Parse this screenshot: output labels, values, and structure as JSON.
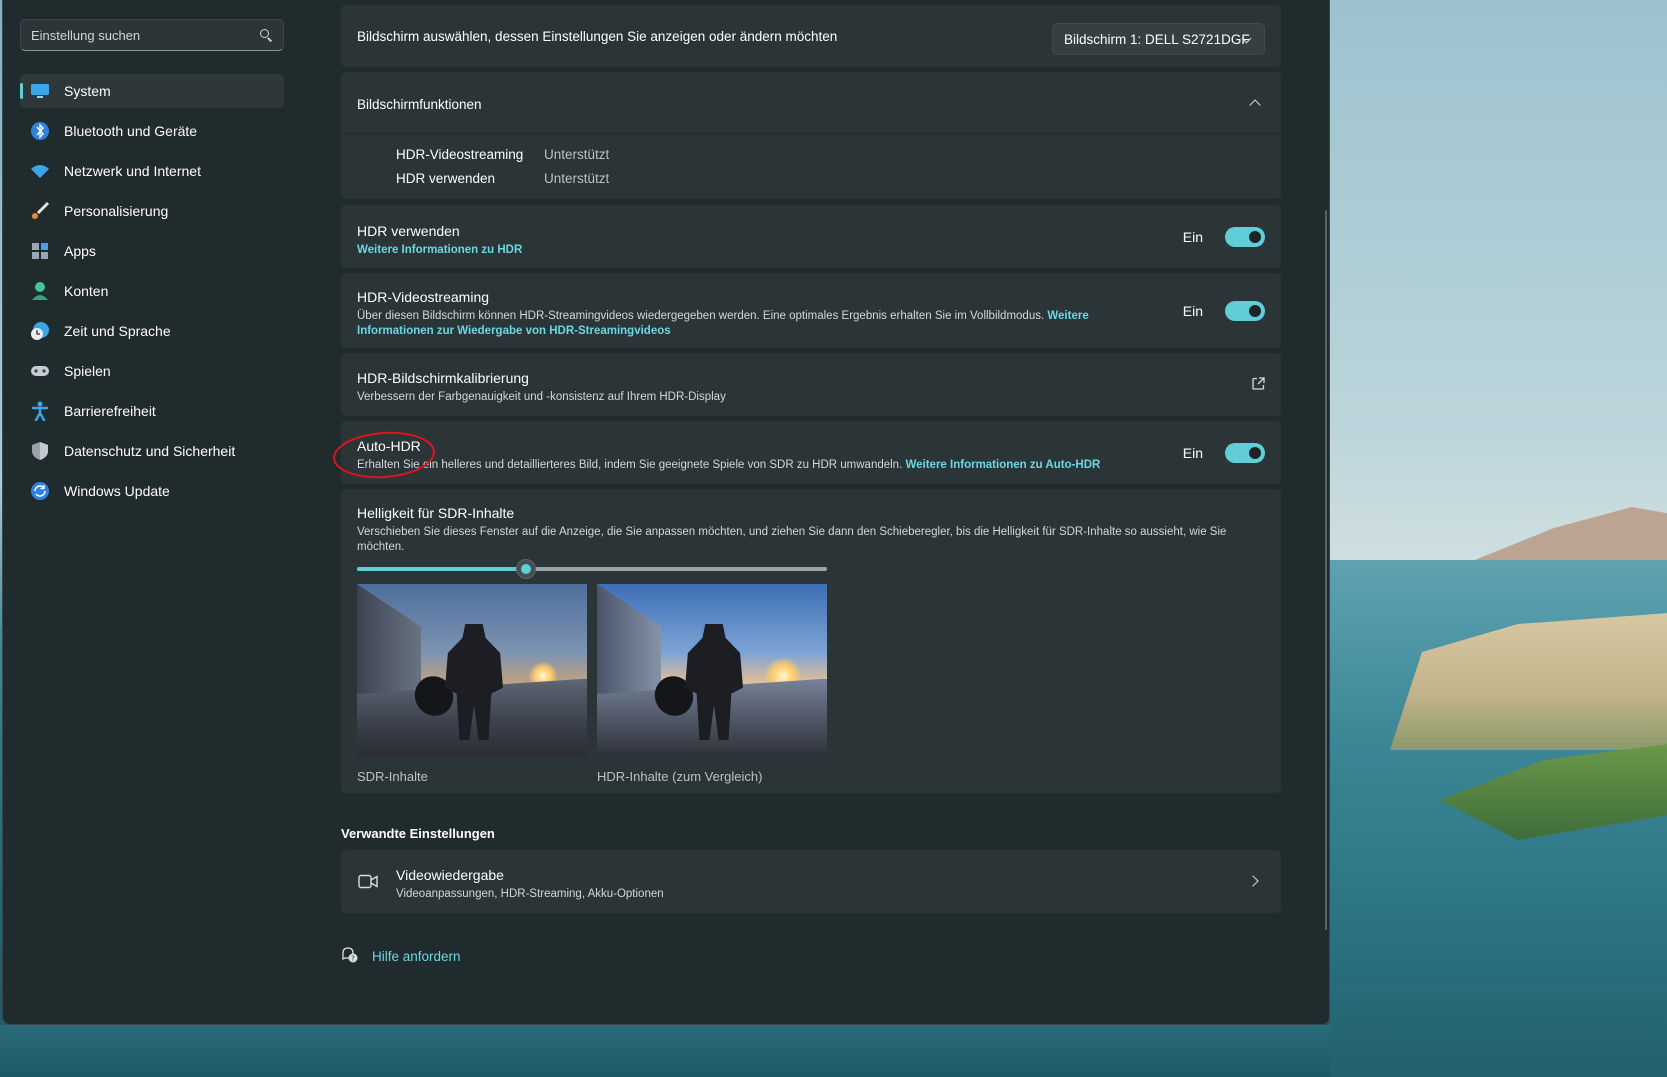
{
  "search": {
    "placeholder": "Einstellung suchen"
  },
  "sidebar": {
    "items": [
      {
        "label": "System",
        "icon": "monitor-icon",
        "active": true
      },
      {
        "label": "Bluetooth und Geräte",
        "icon": "bluetooth-icon"
      },
      {
        "label": "Netzwerk und Internet",
        "icon": "wifi-icon"
      },
      {
        "label": "Personalisierung",
        "icon": "brush-icon"
      },
      {
        "label": "Apps",
        "icon": "apps-icon"
      },
      {
        "label": "Konten",
        "icon": "account-icon"
      },
      {
        "label": "Zeit und Sprache",
        "icon": "clock-globe-icon"
      },
      {
        "label": "Spielen",
        "icon": "gamepad-icon"
      },
      {
        "label": "Barrierefreiheit",
        "icon": "accessibility-icon"
      },
      {
        "label": "Datenschutz und Sicherheit",
        "icon": "shield-icon"
      },
      {
        "label": "Windows Update",
        "icon": "update-icon"
      }
    ]
  },
  "display_select": {
    "label": "Bildschirm auswählen, dessen Einstellungen Sie anzeigen oder ändern möchten",
    "value": "Bildschirm 1: DELL S2721DGF"
  },
  "features": {
    "title": "Bildschirmfunktionen",
    "rows": [
      {
        "name": "HDR-Videostreaming",
        "value": "Unterstützt"
      },
      {
        "name": "HDR verwenden",
        "value": "Unterstützt"
      }
    ]
  },
  "hdr": {
    "title": "HDR verwenden",
    "link": "Weitere Informationen zu HDR",
    "state": "Ein"
  },
  "hdr_streaming": {
    "title": "HDR-Videostreaming",
    "desc": "Über diesen Bildschirm können HDR-Streamingvideos wiedergegeben werden. Eine optimales Ergebnis erhalten Sie im Vollbildmodus.",
    "link": "Weitere Informationen zur Wiedergabe von HDR-Streamingvideos",
    "state": "Ein"
  },
  "calibration": {
    "title": "HDR-Bildschirmkalibrierung",
    "desc": "Verbessern der Farbgenauigkeit und -konsistenz auf Ihrem HDR-Display"
  },
  "auto_hdr": {
    "title": "Auto-HDR",
    "desc": "Erhalten Sie ein helleres und detaillierteres Bild, indem Sie geeignete Spiele von SDR zu HDR umwandeln.",
    "link": "Weitere Informationen zu Auto-HDR",
    "state": "Ein"
  },
  "sdr_brightness": {
    "title": "Helligkeit für SDR-Inhalte",
    "desc": "Verschieben Sie dieses Fenster auf die Anzeige, die Sie anpassen möchten, und ziehen Sie dann den Schieberegler, bis die Helligkeit für SDR-Inhalte so aussieht, wie Sie möchten.",
    "slider_fraction": 0.36,
    "sdr_label": "SDR-Inhalte",
    "hdr_label": "HDR-Inhalte (zum Vergleich)"
  },
  "related": {
    "heading": "Verwandte Einstellungen",
    "video": {
      "title": "Videowiedergabe",
      "desc": "Videoanpassungen, HDR-Streaming, Akku-Optionen"
    }
  },
  "help": {
    "label": "Hilfe anfordern"
  },
  "colors": {
    "accent": "#60cdd8",
    "link": "#6ad7e2",
    "annotation": "#e0141b",
    "window_bg": "#202b2e",
    "card_bg": "#2b3538"
  }
}
